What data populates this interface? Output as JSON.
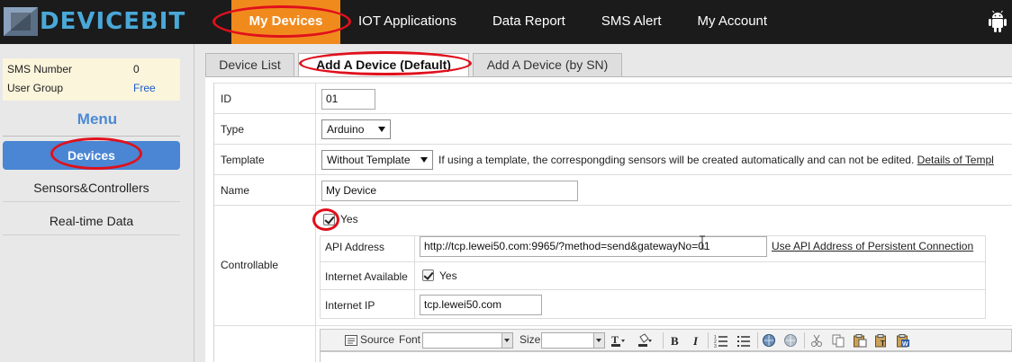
{
  "brand": {
    "name": "DEVICEBIT"
  },
  "nav": {
    "items": [
      {
        "label": "My Devices",
        "active": true
      },
      {
        "label": "IOT Applications"
      },
      {
        "label": "Data Report"
      },
      {
        "label": "SMS Alert"
      },
      {
        "label": "My Account"
      }
    ],
    "right_icon": "android-icon"
  },
  "sidebar": {
    "info": [
      {
        "key": "SMS Number",
        "value": "0"
      },
      {
        "key": "User Group",
        "value": "Free"
      }
    ],
    "menu_title": "Menu",
    "items": [
      {
        "label": "Devices",
        "active": true
      },
      {
        "label": "Sensors&Controllers"
      },
      {
        "label": "Real-time Data"
      }
    ]
  },
  "tabs": [
    {
      "label": "Device List"
    },
    {
      "label": "Add A Device (Default)",
      "active": true
    },
    {
      "label": "Add A Device (by SN)"
    }
  ],
  "form": {
    "id": {
      "label": "ID",
      "value": "01"
    },
    "type": {
      "label": "Type",
      "value": "Arduino"
    },
    "template": {
      "label": "Template",
      "value": "Without Template",
      "note": "If using a template, the correspongding sensors will be created automatically and can not be edited.",
      "link": "Details of Templ"
    },
    "name": {
      "label": "Name",
      "value": "My Device"
    },
    "controllable": {
      "label": "Controllable",
      "checked": true,
      "check_label": "Yes",
      "api_address": {
        "label": "API Address",
        "value": "http://tcp.lewei50.com:9965/?method=send&gatewayNo=01",
        "link": "Use API Address of Persistent Connection"
      },
      "internet_available": {
        "label": "Internet Available",
        "checked": true,
        "check_label": "Yes"
      },
      "internet_ip": {
        "label": "Internet IP",
        "value": "tcp.lewei50.com"
      }
    }
  },
  "editor_toolbar": {
    "source_label": "Source",
    "font_label": "Font",
    "size_label": "Size",
    "icons": [
      "text-color-icon",
      "bg-color-icon",
      "bold-icon",
      "italic-icon",
      "ordered-list-icon",
      "bullet-list-icon",
      "link-icon",
      "unlink-icon",
      "cut-icon",
      "copy-icon",
      "paste-icon",
      "paste-text-icon",
      "paste-word-icon"
    ]
  },
  "colors": {
    "nav_active": "#f18a1d",
    "menu_active": "#4a86d4",
    "annotation": "#e0101c",
    "topbar": "#1b1b1b"
  }
}
